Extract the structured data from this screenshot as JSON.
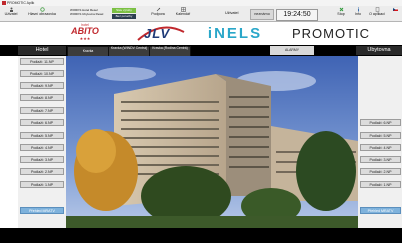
{
  "window": {
    "title": "PROMOTIC Aplik"
  },
  "toolbar": {
    "buttons": [
      {
        "name": "odhlasit-button",
        "label": "Uživatel",
        "icon": "user-icon"
      },
      {
        "name": "hlavni-obrazovka-button",
        "label": "Hlavní obrazovka",
        "icon": "refresh-icon"
      }
    ],
    "info": {
      "line1": "WORKS Hotel Resel",
      "line2": "WORKS Ubytovna Resel",
      "status_green": "Stav výroby",
      "status_dark": "Bez poruchy"
    },
    "buttons2": [
      {
        "name": "podpora-button",
        "label": "Podpora",
        "icon": "tool-icon"
      },
      {
        "name": "kalendar-button",
        "label": "Kalendář",
        "icon": "grid-icon"
      }
    ],
    "user_label": "Uživatel",
    "user_value": "neznámo",
    "clock": "19:24:50",
    "right_buttons": [
      {
        "name": "stop-button",
        "label": "Stop",
        "icon": "stop-icon"
      },
      {
        "name": "info-button",
        "label": "Info",
        "icon": "info-icon"
      },
      {
        "name": "o-aplikaci-button",
        "label": "O aplikaci",
        "icon": "doc-icon"
      },
      {
        "name": "lang-button",
        "label": "",
        "icon": "flag-icon"
      }
    ]
  },
  "logos": {
    "hotel_small": "hotel",
    "abito": "ABITO",
    "stars": "★★★",
    "jlv": "JLV",
    "inels": "iNELS",
    "promotic": "PROMOTIC"
  },
  "nav": {
    "left_title": "Hotel",
    "right_title": "Ubytovna",
    "tabs": [
      "Kravka",
      "Kravka (WINDV Centrá)",
      "Kravka (Rodina Centrá)"
    ],
    "alarm": "ALARMY"
  },
  "hotel_floors": [
    "Podlaží: 11.NP",
    "Podlaží: 10.NP",
    "Podlaží: 9.NP",
    "Podlaží: 8.NP",
    "Podlaží: 7.NP",
    "Podlaží: 6.NP",
    "Podlaží: 5.NP",
    "Podlaží: 4.NP",
    "Podlaží: 3.NP",
    "Podlaží: 2.NP",
    "Podlaží: 1.NP",
    "Přehled MRATV"
  ],
  "ubytovna_floors": [
    "Podlaží: 6.NP",
    "Podlaží: 5.NP",
    "Podlaží: 4.NP",
    "Podlaží: 3.NP",
    "Podlaží: 2.NP",
    "Podlaží: 1.NP",
    "Přehled MRATV"
  ],
  "colors": {
    "accent": "#7eb2dc",
    "nav_bg": "#000000",
    "status_green": "#7bc043",
    "inels": "#2aa7c9",
    "promotic_red": "#c0282d"
  }
}
